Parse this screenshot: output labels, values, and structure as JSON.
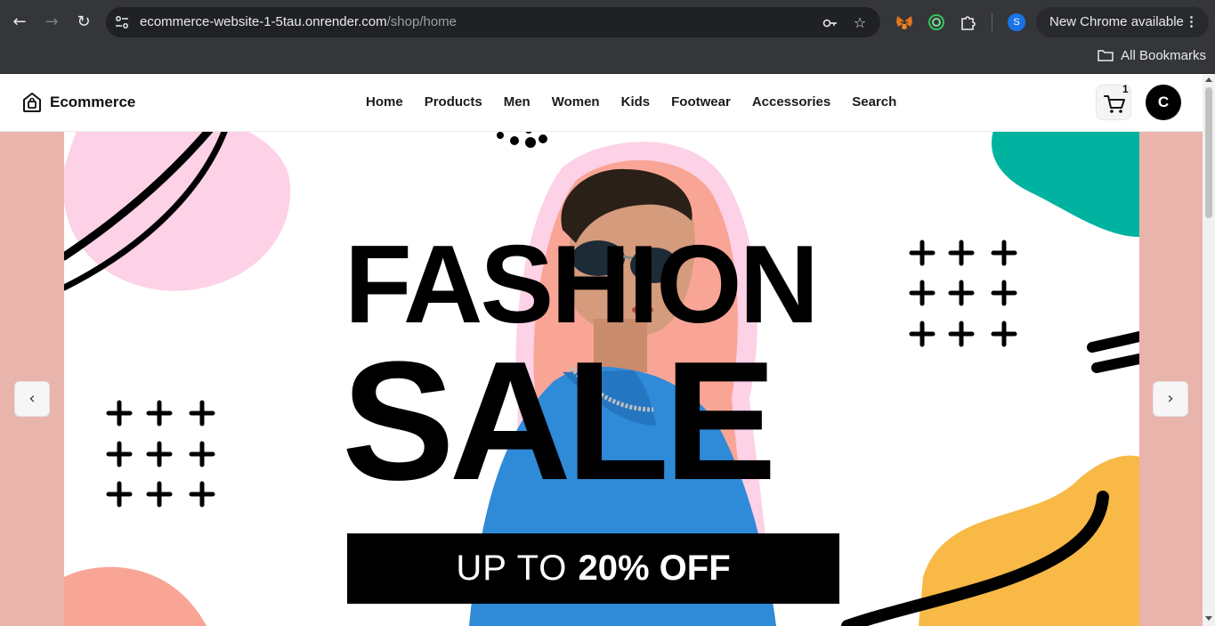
{
  "browser": {
    "url_host": "ecommerce-website-1-5tau.onrender.com",
    "url_path": "/shop/home",
    "profile_initial": "S",
    "update_label": "New Chrome available",
    "bookmarks_label": "All Bookmarks",
    "icons": [
      "back-arrow-icon",
      "forward-arrow-icon",
      "reload-icon",
      "site-settings-icon",
      "password-key-icon",
      "bookmark-star-icon",
      "metamask-extension-icon",
      "circle-extension-icon",
      "puzzle-extension-icon",
      "kebab-menu-icon",
      "folder-icon"
    ]
  },
  "header": {
    "logo_text": "Ecommerce",
    "nav": [
      "Home",
      "Products",
      "Men",
      "Women",
      "Kids",
      "Footwear",
      "Accessories",
      "Search"
    ],
    "cart_count": "1",
    "avatar_initial": "C"
  },
  "hero": {
    "headline_1": "FASHION",
    "headline_2": "SALE",
    "offer_light": "UP TO ",
    "offer_bold": "20% OFF",
    "prev_label": "‹",
    "next_label": "›"
  },
  "colors": {
    "hero_sides": "#e8b4ac",
    "blob_pink": "#fdd1e6",
    "blob_teal": "#00b3a1",
    "blob_yellow": "#f8b946",
    "blob_salmon": "#f9a596",
    "shirt_blue": "#2f8ad8"
  }
}
